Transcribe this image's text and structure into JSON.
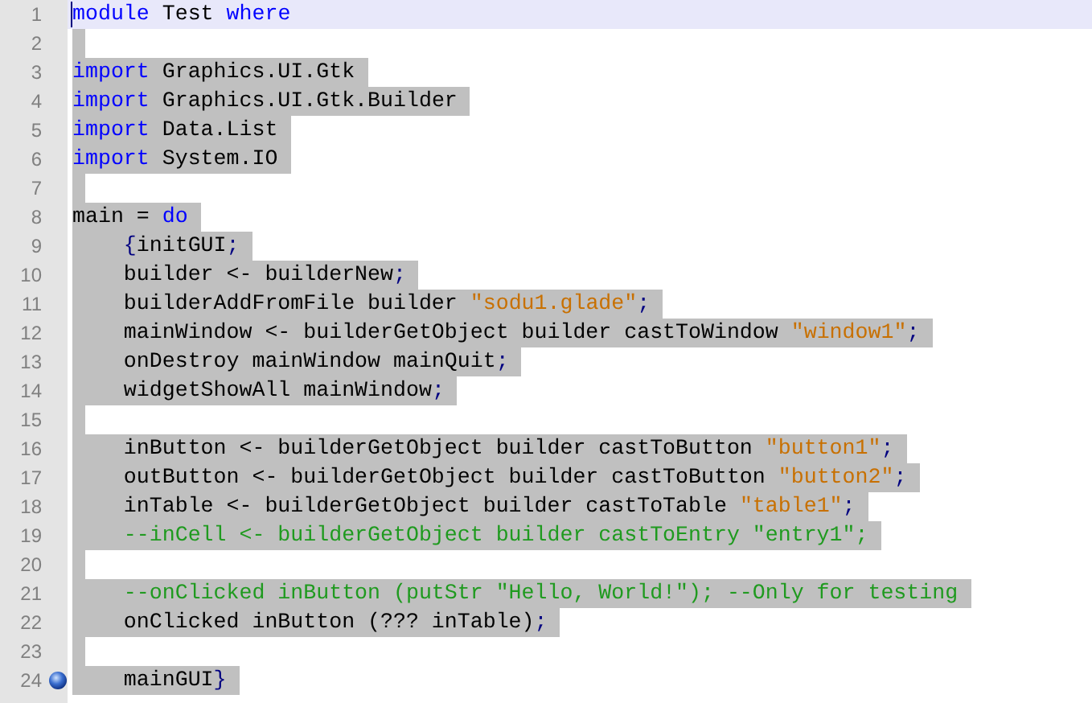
{
  "editor": {
    "lines": [
      {
        "number": "1",
        "current": true,
        "selected": false,
        "breakpoint": false,
        "tokens": [
          {
            "kind": "keyword",
            "text": "module"
          },
          {
            "kind": "plain",
            "text": " Test "
          },
          {
            "kind": "keyword",
            "text": "where"
          }
        ]
      },
      {
        "number": "2",
        "current": false,
        "selected": true,
        "breakpoint": false
      },
      {
        "number": "3",
        "current": false,
        "selected": true,
        "breakpoint": false,
        "tokens": [
          {
            "kind": "keyword",
            "text": "import"
          },
          {
            "kind": "plain",
            "text": " Graphics.UI.Gtk"
          }
        ]
      },
      {
        "number": "4",
        "current": false,
        "selected": true,
        "breakpoint": false,
        "tokens": [
          {
            "kind": "keyword",
            "text": "import"
          },
          {
            "kind": "plain",
            "text": " Graphics.UI.Gtk.Builder"
          }
        ]
      },
      {
        "number": "5",
        "current": false,
        "selected": true,
        "breakpoint": false,
        "tokens": [
          {
            "kind": "keyword",
            "text": "import"
          },
          {
            "kind": "plain",
            "text": " Data.List"
          }
        ]
      },
      {
        "number": "6",
        "current": false,
        "selected": true,
        "breakpoint": false,
        "tokens": [
          {
            "kind": "keyword",
            "text": "import"
          },
          {
            "kind": "plain",
            "text": " System.IO"
          }
        ]
      },
      {
        "number": "7",
        "current": false,
        "selected": true,
        "breakpoint": false
      },
      {
        "number": "8",
        "current": false,
        "selected": true,
        "breakpoint": false,
        "tokens": [
          {
            "kind": "plain",
            "text": "main = "
          },
          {
            "kind": "keyword",
            "text": "do"
          }
        ]
      },
      {
        "number": "9",
        "current": false,
        "selected": true,
        "breakpoint": false,
        "tokens": [
          {
            "kind": "punct",
            "text": "    {"
          },
          {
            "kind": "plain",
            "text": "initGUI"
          },
          {
            "kind": "punct",
            "text": ";"
          }
        ]
      },
      {
        "number": "10",
        "current": false,
        "selected": true,
        "breakpoint": false,
        "tokens": [
          {
            "kind": "plain",
            "text": "    builder <- builderNew"
          },
          {
            "kind": "punct",
            "text": ";"
          }
        ]
      },
      {
        "number": "11",
        "current": false,
        "selected": true,
        "breakpoint": false,
        "tokens": [
          {
            "kind": "plain",
            "text": "    builderAddFromFile builder "
          },
          {
            "kind": "string",
            "text": "\"sodu1.glade\""
          },
          {
            "kind": "punct",
            "text": ";"
          }
        ]
      },
      {
        "number": "12",
        "current": false,
        "selected": true,
        "breakpoint": false,
        "tokens": [
          {
            "kind": "plain",
            "text": "    mainWindow <- builderGetObject builder castToWindow "
          },
          {
            "kind": "string",
            "text": "\"window1\""
          },
          {
            "kind": "punct",
            "text": ";"
          }
        ]
      },
      {
        "number": "13",
        "current": false,
        "selected": true,
        "breakpoint": false,
        "tokens": [
          {
            "kind": "plain",
            "text": "    onDestroy mainWindow mainQuit"
          },
          {
            "kind": "punct",
            "text": ";"
          }
        ]
      },
      {
        "number": "14",
        "current": false,
        "selected": true,
        "breakpoint": false,
        "tokens": [
          {
            "kind": "plain",
            "text": "    widgetShowAll mainWindow"
          },
          {
            "kind": "punct",
            "text": ";"
          }
        ]
      },
      {
        "number": "15",
        "current": false,
        "selected": true,
        "breakpoint": false
      },
      {
        "number": "16",
        "current": false,
        "selected": true,
        "breakpoint": false,
        "tokens": [
          {
            "kind": "plain",
            "text": "    inButton <- builderGetObject builder castToButton "
          },
          {
            "kind": "string",
            "text": "\"button1\""
          },
          {
            "kind": "punct",
            "text": ";"
          }
        ]
      },
      {
        "number": "17",
        "current": false,
        "selected": true,
        "breakpoint": false,
        "tokens": [
          {
            "kind": "plain",
            "text": "    outButton <- builderGetObject builder castToButton "
          },
          {
            "kind": "string",
            "text": "\"button2\""
          },
          {
            "kind": "punct",
            "text": ";"
          }
        ]
      },
      {
        "number": "18",
        "current": false,
        "selected": true,
        "breakpoint": false,
        "tokens": [
          {
            "kind": "plain",
            "text": "    inTable <- builderGetObject builder castToTable "
          },
          {
            "kind": "string",
            "text": "\"table1\""
          },
          {
            "kind": "punct",
            "text": ";"
          }
        ]
      },
      {
        "number": "19",
        "current": false,
        "selected": true,
        "breakpoint": false,
        "tokens": [
          {
            "kind": "comment",
            "text": "    --inCell <- builderGetObject builder castToEntry \"entry1\";"
          }
        ]
      },
      {
        "number": "20",
        "current": false,
        "selected": true,
        "breakpoint": false
      },
      {
        "number": "21",
        "current": false,
        "selected": true,
        "breakpoint": false,
        "tokens": [
          {
            "kind": "comment",
            "text": "    --onClicked inButton (putStr \"Hello, World!\"); --Only for testing"
          }
        ]
      },
      {
        "number": "22",
        "current": false,
        "selected": true,
        "breakpoint": false,
        "tokens": [
          {
            "kind": "plain",
            "text": "    onClicked inButton (??? inTable)"
          },
          {
            "kind": "punct",
            "text": ";"
          }
        ]
      },
      {
        "number": "23",
        "current": false,
        "selected": true,
        "breakpoint": false
      },
      {
        "number": "24",
        "current": false,
        "selected": true,
        "breakpoint": true,
        "tokens": [
          {
            "kind": "plain",
            "text": "    mainGUI"
          },
          {
            "kind": "punct",
            "text": "}"
          }
        ]
      }
    ]
  }
}
